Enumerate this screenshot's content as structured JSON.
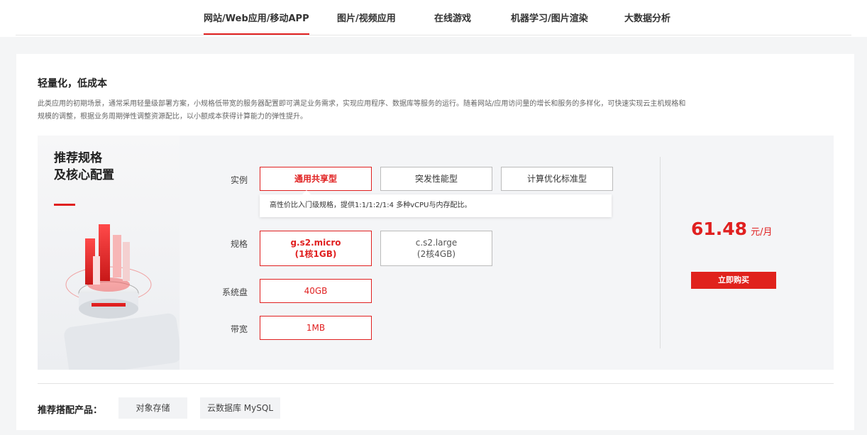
{
  "tabs": [
    {
      "label": "网站/Web应用/移动APP",
      "active": true
    },
    {
      "label": "图片/视频应用",
      "active": false
    },
    {
      "label": "在线游戏",
      "active": false
    },
    {
      "label": "机器学习/图片渲染",
      "active": false
    },
    {
      "label": "大数据分析",
      "active": false
    }
  ],
  "section": {
    "heading": "轻量化，低成本",
    "description": "此类应用的初期场景，通常采用轻量级部署方案，小规格低带宽的服务器配置即可满足业务需求，实现应用程序、数据库等服务的运行。随着网站/应用访问量的增长和服务的多样化，可快速实现云主机规格和规模的调整，根据业务周期弹性调整资源配比，以小额成本获得计算能力的弹性提升。"
  },
  "left_card": {
    "title_line1": "推荐规格",
    "title_line2": "及核心配置"
  },
  "config": {
    "instance": {
      "label": "实例",
      "options": [
        "通用共享型",
        "突发性能型",
        "计算优化标准型"
      ],
      "selected": "通用共享型",
      "tooltip": "高性价比入门级规格，提供1:1/1:2/1:4 多种vCPU与内存配比。"
    },
    "spec": {
      "label": "规格",
      "options": [
        {
          "name": "g.s2.micro",
          "detail": "(1核1GB)"
        },
        {
          "name": "c.s2.large",
          "detail": "(2核4GB)"
        }
      ],
      "selected": "g.s2.micro"
    },
    "disk": {
      "label": "系统盘",
      "value": "40GB"
    },
    "bandwidth": {
      "label": "带宽",
      "value": "1MB"
    }
  },
  "pricing": {
    "amount": "61.48",
    "unit": "元/月",
    "buy_label": "立即购买"
  },
  "recommend": {
    "label": "推荐搭配产品：",
    "products": [
      "对象存储",
      "云数据库 MySQL"
    ]
  },
  "colors": {
    "accent": "#e02020",
    "buy_button": "#e0221c"
  }
}
